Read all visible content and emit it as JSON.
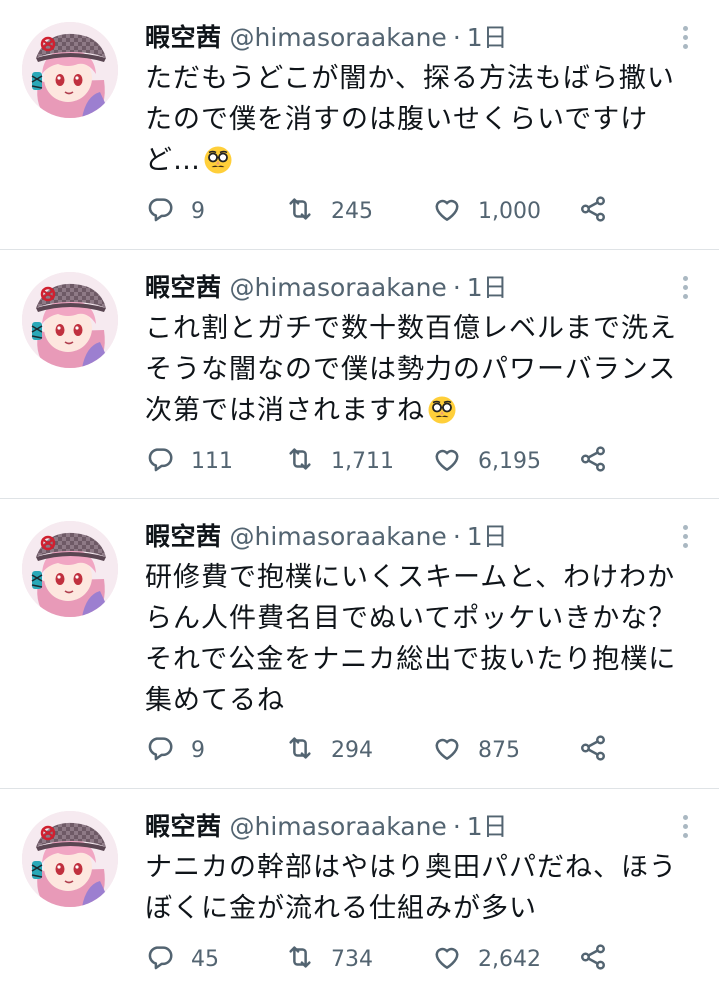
{
  "tweets": [
    {
      "name": "暇空茜",
      "handle": "@himasoraakane",
      "separator": "·",
      "time": "1日",
      "text": "ただもうどこが闇か、探る方法もばら撒いたので僕を消すのは腹いせくらいですけど…",
      "emoji": "disguise-face",
      "replies": "9",
      "retweets": "245",
      "likes": "1,000"
    },
    {
      "name": "暇空茜",
      "handle": "@himasoraakane",
      "separator": "·",
      "time": "1日",
      "text": "これ割とガチで数十数百億レベルまで洗えそうな闇なので僕は勢力のパワーバランス次第では消されますね",
      "emoji": "disguise-face",
      "replies": "111",
      "retweets": "1,711",
      "likes": "6,195"
    },
    {
      "name": "暇空茜",
      "handle": "@himasoraakane",
      "separator": "·",
      "time": "1日",
      "text": "研修費で抱樸にいくスキームと、わけわからん人件費名目でぬいてポッケいきかな？それで公金をナニカ総出で抜いたり抱樸に集めてるね",
      "emoji": "",
      "replies": "9",
      "retweets": "294",
      "likes": "875"
    },
    {
      "name": "暇空茜",
      "handle": "@himasoraakane",
      "separator": "·",
      "time": "1日",
      "text": "ナニカの幹部はやはり奥田パパだね、ほうぼくに金が流れる仕組みが多い",
      "emoji": "",
      "replies": "45",
      "retweets": "734",
      "likes": "2,642"
    }
  ],
  "icons": {
    "reply": "reply-icon",
    "retweet": "retweet-icon",
    "like": "heart-icon",
    "share": "share-icon",
    "more": "more-vertical-icon"
  },
  "colors": {
    "text": "#0f1419",
    "secondary": "#536471",
    "divider": "#dfe3e6"
  }
}
